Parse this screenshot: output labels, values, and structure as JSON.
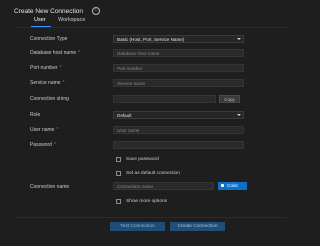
{
  "dialog": {
    "title": "Create New Connection",
    "info_icon": "info-icon"
  },
  "tabs": [
    {
      "label": "User"
    },
    {
      "label": "Workspace"
    }
  ],
  "form": {
    "connection_type": {
      "label": "Connection Type",
      "value": "Basic (Host, Port, Service Name)"
    },
    "host": {
      "label": "Database host name",
      "placeholder": "Database host name"
    },
    "port": {
      "label": "Port number",
      "placeholder": "Port number"
    },
    "service": {
      "label": "Service name",
      "placeholder": "Service name"
    },
    "connection_string": {
      "label": "Connection string",
      "copy_label": "Copy"
    },
    "role": {
      "label": "Role",
      "value": "Default"
    },
    "username": {
      "label": "User name",
      "placeholder": "User name"
    },
    "password": {
      "label": "Password"
    },
    "save_password": {
      "label": "Save password",
      "checked": false
    },
    "default_connection": {
      "label": "Set as default connection",
      "checked": false
    },
    "connection_name": {
      "label": "Connection name",
      "placeholder": "Connection name",
      "color_label": "Color"
    },
    "more_options": {
      "label": "Show more options",
      "checked": false
    }
  },
  "required_mark": "*",
  "actions": {
    "test_label": "Test Connection",
    "create_label": "Create Connection"
  },
  "colors": {
    "accent": "#0e6fc7",
    "required": "#f14c4c",
    "background": "#1e1e1e"
  }
}
